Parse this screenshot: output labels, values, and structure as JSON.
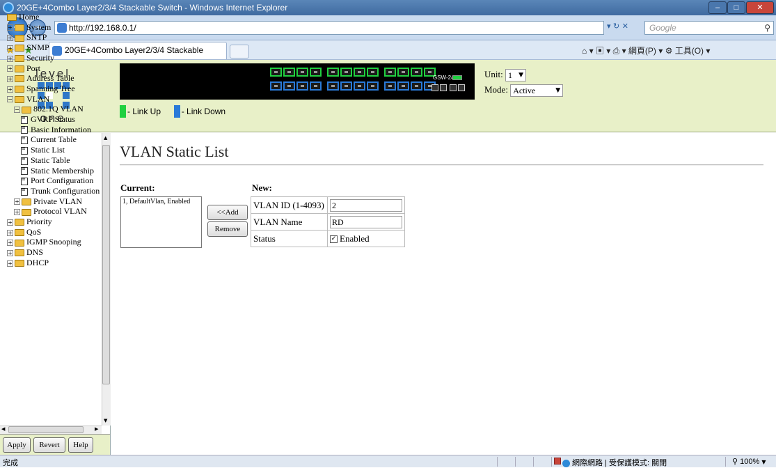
{
  "window": {
    "title": "20GE+4Combo Layer2/3/4 Stackable Switch - Windows Internet Explorer"
  },
  "browser": {
    "url": "http://192.168.0.1/",
    "search_placeholder": "Google",
    "tab_title": "20GE+4Combo Layer2/3/4 Stackable Switch",
    "toolbar_text": "⌂ ▾ ▣ ▾ ⎙ ▾ 網頁(P) ▾ ⚙ 工具(O) ▾"
  },
  "banner": {
    "logo_top": "level",
    "logo_bottom": "one",
    "model": "GSW-2495",
    "legend": {
      "link_up": "- Link Up",
      "link_down": "- Link Down"
    },
    "unit_label": "Unit:",
    "unit_value": "1",
    "mode_label": "Mode:",
    "mode_value": "Active",
    "colors": {
      "link_up": "#20d040",
      "link_down": "#2a7ad8",
      "banner_bg": "#e8f0c8"
    }
  },
  "tree": {
    "items": [
      {
        "label": "Home",
        "type": "folder-open",
        "level": 0
      },
      {
        "label": "System",
        "type": "folder",
        "level": 0
      },
      {
        "label": "SNTP",
        "type": "folder",
        "level": 0
      },
      {
        "label": "SNMP",
        "type": "folder",
        "level": 0
      },
      {
        "label": "Security",
        "type": "folder",
        "level": 0
      },
      {
        "label": "Port",
        "type": "folder",
        "level": 0
      },
      {
        "label": "Address Table",
        "type": "folder",
        "level": 0
      },
      {
        "label": "Spanning Tree",
        "type": "folder",
        "level": 0
      },
      {
        "label": "VLAN",
        "type": "folder-open",
        "level": 0
      },
      {
        "label": "802.1Q VLAN",
        "type": "folder-open",
        "level": 1
      },
      {
        "label": "GVRP Status",
        "type": "doc",
        "level": 2
      },
      {
        "label": "Basic Information",
        "type": "doc",
        "level": 2
      },
      {
        "label": "Current Table",
        "type": "doc",
        "level": 2
      },
      {
        "label": "Static List",
        "type": "doc",
        "level": 2
      },
      {
        "label": "Static Table",
        "type": "doc",
        "level": 2
      },
      {
        "label": "Static Membership",
        "type": "doc",
        "level": 2
      },
      {
        "label": "Port Configuration",
        "type": "doc",
        "level": 2
      },
      {
        "label": "Trunk Configuration",
        "type": "doc",
        "level": 2
      },
      {
        "label": "Private VLAN",
        "type": "folder",
        "level": 1
      },
      {
        "label": "Protocol VLAN",
        "type": "folder",
        "level": 1
      },
      {
        "label": "Priority",
        "type": "folder",
        "level": 0
      },
      {
        "label": "QoS",
        "type": "folder",
        "level": 0
      },
      {
        "label": "IGMP Snooping",
        "type": "folder",
        "level": 0
      },
      {
        "label": "DNS",
        "type": "folder",
        "level": 0
      },
      {
        "label": "DHCP",
        "type": "folder",
        "level": 0
      }
    ]
  },
  "buttons": {
    "apply": "Apply",
    "revert": "Revert",
    "help": "Help"
  },
  "main": {
    "title": "VLAN Static List",
    "current_label": "Current:",
    "new_label": "New:",
    "current_items": [
      "1, DefaultVlan, Enabled"
    ],
    "add_button": "<<Add",
    "remove_button": "Remove",
    "fields": {
      "vlan_id_label": "VLAN ID (1-4093)",
      "vlan_id_value": "2",
      "vlan_name_label": "VLAN Name",
      "vlan_name_value": "RD",
      "status_label": "Status",
      "status_option": "Enabled",
      "status_checked": true
    }
  },
  "statusbar": {
    "text": "完成",
    "zone": "網際網路 | 受保護模式: 關閉",
    "zoom": "100%"
  }
}
